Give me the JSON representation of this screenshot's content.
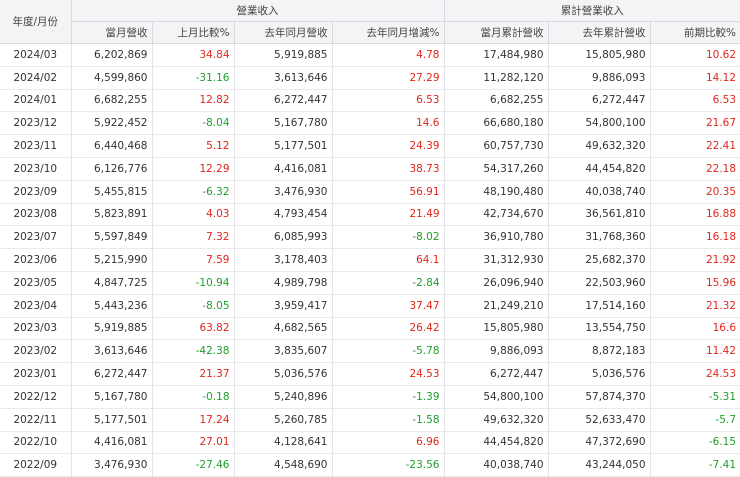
{
  "table": {
    "first_header": "年度/月份",
    "groups": [
      {
        "label": "營業收入",
        "span": 4
      },
      {
        "label": "累計營業收入",
        "span": 3
      }
    ],
    "columns": [
      "當月營收",
      "上月比較%",
      "去年同月營收",
      "去年同月增減%",
      "當月累計營收",
      "去年累計營收",
      "前期比較%"
    ],
    "colors": {
      "positive": "#e0271e",
      "negative": "#1f9e2c"
    },
    "rows": [
      [
        "2024/03",
        "6,202,869",
        "34.84",
        "5,919,885",
        "4.78",
        "17,484,980",
        "15,805,980",
        "10.62"
      ],
      [
        "2024/02",
        "4,599,860",
        "-31.16",
        "3,613,646",
        "27.29",
        "11,282,120",
        "9,886,093",
        "14.12"
      ],
      [
        "2024/01",
        "6,682,255",
        "12.82",
        "6,272,447",
        "6.53",
        "6,682,255",
        "6,272,447",
        "6.53"
      ],
      [
        "2023/12",
        "5,922,452",
        "-8.04",
        "5,167,780",
        "14.6",
        "66,680,180",
        "54,800,100",
        "21.67"
      ],
      [
        "2023/11",
        "6,440,468",
        "5.12",
        "5,177,501",
        "24.39",
        "60,757,730",
        "49,632,320",
        "22.41"
      ],
      [
        "2023/10",
        "6,126,776",
        "12.29",
        "4,416,081",
        "38.73",
        "54,317,260",
        "44,454,820",
        "22.18"
      ],
      [
        "2023/09",
        "5,455,815",
        "-6.32",
        "3,476,930",
        "56.91",
        "48,190,480",
        "40,038,740",
        "20.35"
      ],
      [
        "2023/08",
        "5,823,891",
        "4.03",
        "4,793,454",
        "21.49",
        "42,734,670",
        "36,561,810",
        "16.88"
      ],
      [
        "2023/07",
        "5,597,849",
        "7.32",
        "6,085,993",
        "-8.02",
        "36,910,780",
        "31,768,360",
        "16.18"
      ],
      [
        "2023/06",
        "5,215,990",
        "7.59",
        "3,178,403",
        "64.1",
        "31,312,930",
        "25,682,370",
        "21.92"
      ],
      [
        "2023/05",
        "4,847,725",
        "-10.94",
        "4,989,798",
        "-2.84",
        "26,096,940",
        "22,503,960",
        "15.96"
      ],
      [
        "2023/04",
        "5,443,236",
        "-8.05",
        "3,959,417",
        "37.47",
        "21,249,210",
        "17,514,160",
        "21.32"
      ],
      [
        "2023/03",
        "5,919,885",
        "63.82",
        "4,682,565",
        "26.42",
        "15,805,980",
        "13,554,750",
        "16.6"
      ],
      [
        "2023/02",
        "3,613,646",
        "-42.38",
        "3,835,607",
        "-5.78",
        "9,886,093",
        "8,872,183",
        "11.42"
      ],
      [
        "2023/01",
        "6,272,447",
        "21.37",
        "5,036,576",
        "24.53",
        "6,272,447",
        "5,036,576",
        "24.53"
      ],
      [
        "2022/12",
        "5,167,780",
        "-0.18",
        "5,240,896",
        "-1.39",
        "54,800,100",
        "57,874,370",
        "-5.31"
      ],
      [
        "2022/11",
        "5,177,501",
        "17.24",
        "5,260,785",
        "-1.58",
        "49,632,320",
        "52,633,470",
        "-5.7"
      ],
      [
        "2022/10",
        "4,416,081",
        "27.01",
        "4,128,641",
        "6.96",
        "44,454,820",
        "47,372,690",
        "-6.15"
      ],
      [
        "2022/09",
        "3,476,930",
        "-27.46",
        "4,548,690",
        "-23.56",
        "40,038,740",
        "43,244,050",
        "-7.41"
      ]
    ]
  }
}
